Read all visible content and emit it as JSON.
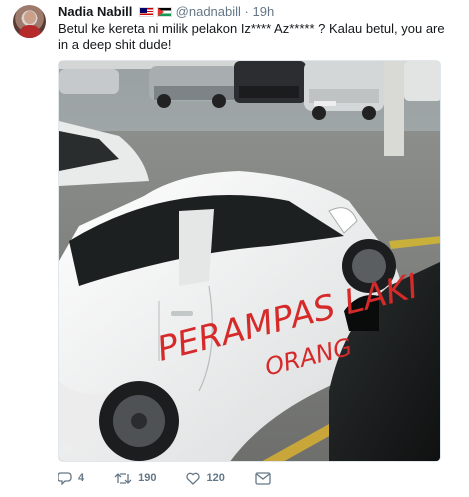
{
  "tweet": {
    "author_name": "Nadia Nabill",
    "handle": "@nadnabill",
    "separator": "·",
    "time": "19h",
    "text": "Betul ke kereta ni milik pelakon Iz**** Az***** ? Kalau betul, you are in a deep shit dude!",
    "photo": {
      "graffiti_line1": "PERAMPAS LAKI",
      "graffiti_line2": "ORANG"
    },
    "actions": {
      "replies": "4",
      "retweets": "190",
      "likes": "120"
    }
  },
  "colors": {
    "text": "#14171a",
    "muted": "#657786",
    "graffiti": "#d62a2a"
  },
  "icons": [
    "reply-icon",
    "retweet-icon",
    "like-icon",
    "direct-message-icon"
  ]
}
